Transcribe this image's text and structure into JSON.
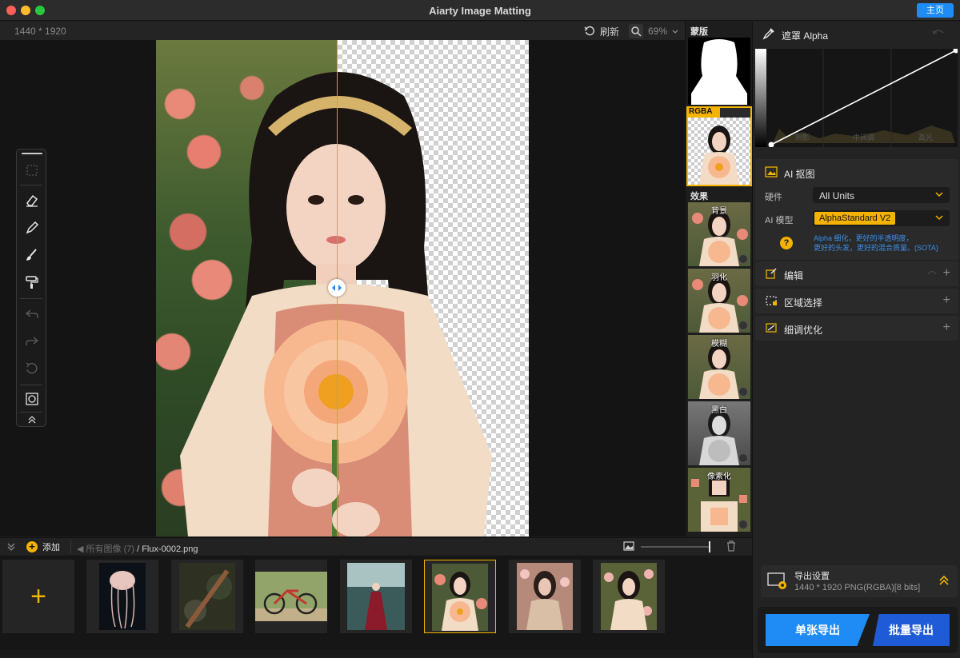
{
  "window": {
    "title": "Aiarty Image Matting",
    "home_label": "主页"
  },
  "canvas": {
    "dimensions": "1440 * 1920",
    "refresh_label": "刷新",
    "zoom": "69%"
  },
  "thumbnail_column": {
    "mask_label": "蒙版",
    "rgba_badge": "RGBA",
    "effects_label": "效果",
    "effects": [
      {
        "label": "背景"
      },
      {
        "label": "羽化"
      },
      {
        "label": "模糊"
      },
      {
        "label": "黑白"
      },
      {
        "label": "像素化"
      }
    ]
  },
  "right_panel": {
    "alpha_title": "遮罩 Alpha",
    "curve_labels": [
      "阴影",
      "中间调",
      "高光"
    ],
    "ai_matting": {
      "title": "AI 抠图",
      "hardware_label": "硬件",
      "hardware_value": "All Units",
      "model_label": "AI 模型",
      "model_value": "AlphaStandard  V2",
      "model_desc_1": "Alpha 细化，更好的半透明度，",
      "model_desc_2": "更好的头发，更好的混合质量。(SOTA)"
    },
    "sections": [
      {
        "title": "编辑"
      },
      {
        "title": "区域选择"
      },
      {
        "title": "细调优化"
      }
    ],
    "export": {
      "title": "导出设置",
      "info": "1440 * 1920 PNG(RGBA)[8 bits]",
      "single_label": "单张导出",
      "batch_label": "批量导出"
    }
  },
  "filmstrip": {
    "add_label": "添加",
    "path_all": "所有图像 (7)",
    "path_file": "/ Flux-0002.png",
    "images": [
      {
        "name": "jellyfish",
        "selected": false
      },
      {
        "name": "forest-sword",
        "selected": false
      },
      {
        "name": "bicycle",
        "selected": false
      },
      {
        "name": "red-dress-forest",
        "selected": false
      },
      {
        "name": "girl-with-flower",
        "selected": true
      },
      {
        "name": "woman-portrait-flowers",
        "selected": false
      },
      {
        "name": "girl-portrait-roses",
        "selected": false
      }
    ]
  },
  "colors": {
    "accent_yellow": "#f3b300",
    "accent_blue": "#1f8cf5"
  }
}
